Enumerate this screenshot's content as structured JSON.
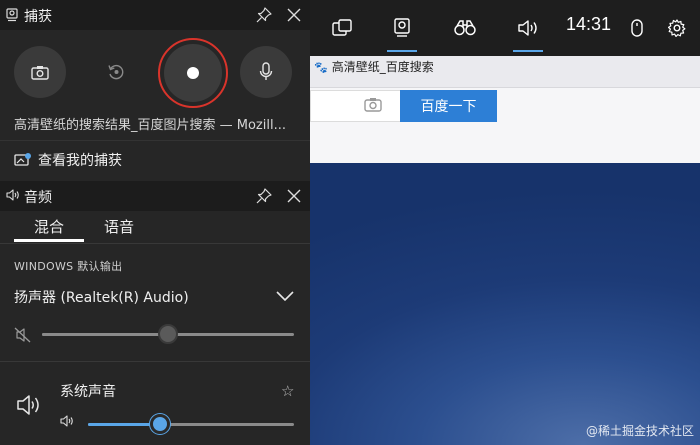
{
  "browser": {
    "tab_title": "高清壁纸_百度搜索",
    "search_button": "百度一下"
  },
  "watermark": "@稀土掘金技术社区",
  "topbar": {
    "time": "14:31",
    "items": [
      "widget-menu-icon",
      "capture-icon",
      "binoculars-icon",
      "audio-icon",
      "mouse-icon",
      "settings-icon"
    ],
    "active_items": [
      "capture-icon",
      "audio-icon"
    ]
  },
  "capture": {
    "title": "捕获",
    "source_title": "高清壁纸的搜索结果_百度图片搜索 — Mozill...",
    "gallery_link": "查看我的捕获"
  },
  "audio": {
    "title": "音频",
    "tabs": [
      {
        "label": "混合",
        "active": true
      },
      {
        "label": "语音",
        "active": false
      }
    ],
    "section_label": "WINDOWS 默认输出",
    "device": "扬声器 (Realtek(R) Audio)",
    "device_volume": 0.5,
    "device_muted": true,
    "apps": [
      {
        "name": "系统声音",
        "volume": 0.35
      }
    ]
  },
  "colors": {
    "accent": "#5aa6e8",
    "record_ring": "#d9342b",
    "panel_bg": "#262626",
    "topbar_bg": "#1e1e1e",
    "baidu_button": "#2d7fd6"
  }
}
